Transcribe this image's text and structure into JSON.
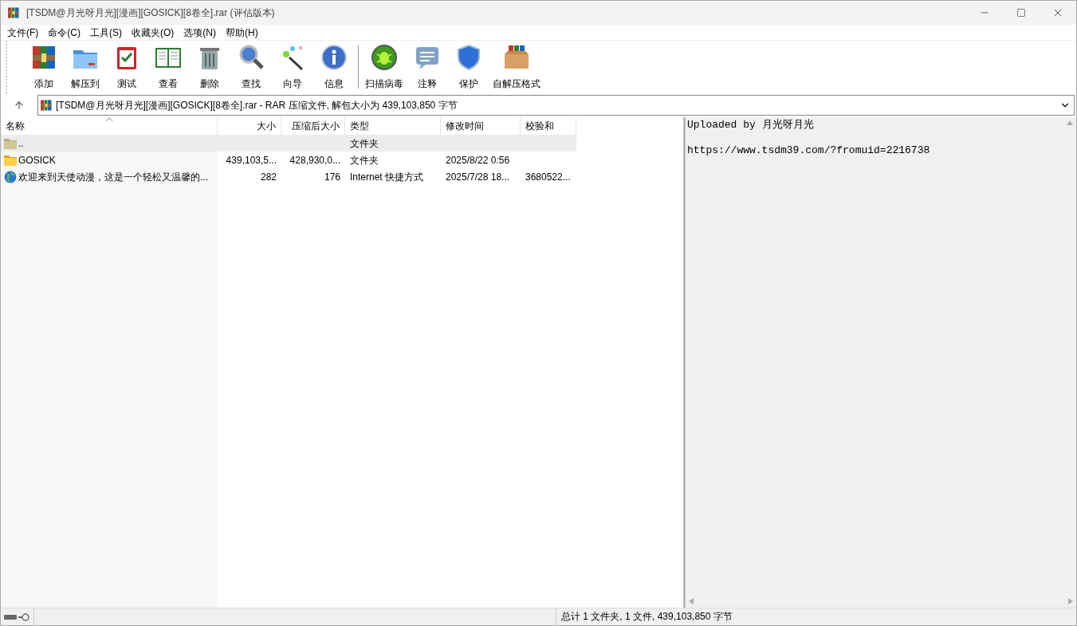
{
  "window": {
    "title": "[TSDM@月光呀月光][漫画][GOSICK][8卷全].rar (评估版本)"
  },
  "menu": [
    "文件(F)",
    "命令(C)",
    "工具(S)",
    "收藏夹(O)",
    "选项(N)",
    "帮助(H)"
  ],
  "toolbar": {
    "groups": [
      [
        "添加",
        "解压到",
        "测试",
        "查看",
        "删除",
        "查找",
        "向导",
        "信息"
      ],
      [
        "扫描病毒",
        "注释",
        "保护",
        "自解压格式"
      ]
    ]
  },
  "address": {
    "value": "[TSDM@月光呀月光][漫画][GOSICK][8卷全].rar - RAR 压缩文件, 解包大小为 439,103,850 字节"
  },
  "table": {
    "columns": [
      {
        "label": "名称",
        "sorted": true
      },
      {
        "label": "大小",
        "sorted": false
      },
      {
        "label": "压缩后大小",
        "sorted": false
      },
      {
        "label": "类型",
        "sorted": false
      },
      {
        "label": "修改时间",
        "sorted": false
      },
      {
        "label": "校验和",
        "sorted": false
      }
    ],
    "rows": [
      {
        "kind": "parent",
        "selected": true,
        "cells": [
          "..",
          "",
          "",
          "文件夹",
          "",
          ""
        ]
      },
      {
        "kind": "folder",
        "selected": false,
        "cells": [
          "GOSICK",
          "439,103,5...",
          "428,930,0...",
          "文件夹",
          "2025/8/22 0:56",
          ""
        ]
      },
      {
        "kind": "link",
        "selected": false,
        "cells": [
          "欢迎来到天使动漫，这是一个轻松又温馨的...",
          "282",
          "176",
          "Internet 快捷方式",
          "2025/7/28 18...",
          "3680522..."
        ]
      }
    ]
  },
  "comment": [
    "Uploaded by 月光呀月光",
    "https://www.tsdm39.com/?fromuid=2216738"
  ],
  "status_bar": {
    "text": "总计 1 文件夹, 1 文件, 439,103,850 字节"
  }
}
